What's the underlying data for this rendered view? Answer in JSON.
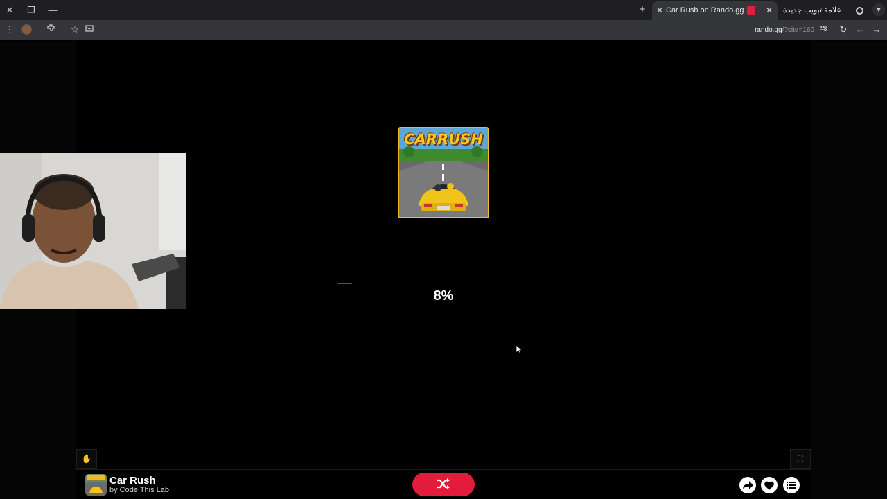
{
  "browser": {
    "tabs": [
      {
        "title": "Car Rush on Rando.gg",
        "active": true
      },
      {
        "title": "علامة تبويب جديدة",
        "active": false
      }
    ],
    "address": {
      "domain": "rando.gg",
      "path": "/?site=160"
    }
  },
  "game": {
    "cover_word": "CARRUSH",
    "loading_percent": "8%",
    "loading_fraction": 0.08,
    "title": "Car Rush",
    "author": "by Code This Lab"
  },
  "colors": {
    "accent": "#e21c3a",
    "cover_border": "#f1b92a",
    "chrome_bg": "#35363a"
  },
  "icons": {
    "shuffle": "shuffle-icon",
    "share": "share-icon",
    "like": "heart-icon",
    "menu": "list-icon",
    "fullscreen": "fullscreen-icon"
  }
}
